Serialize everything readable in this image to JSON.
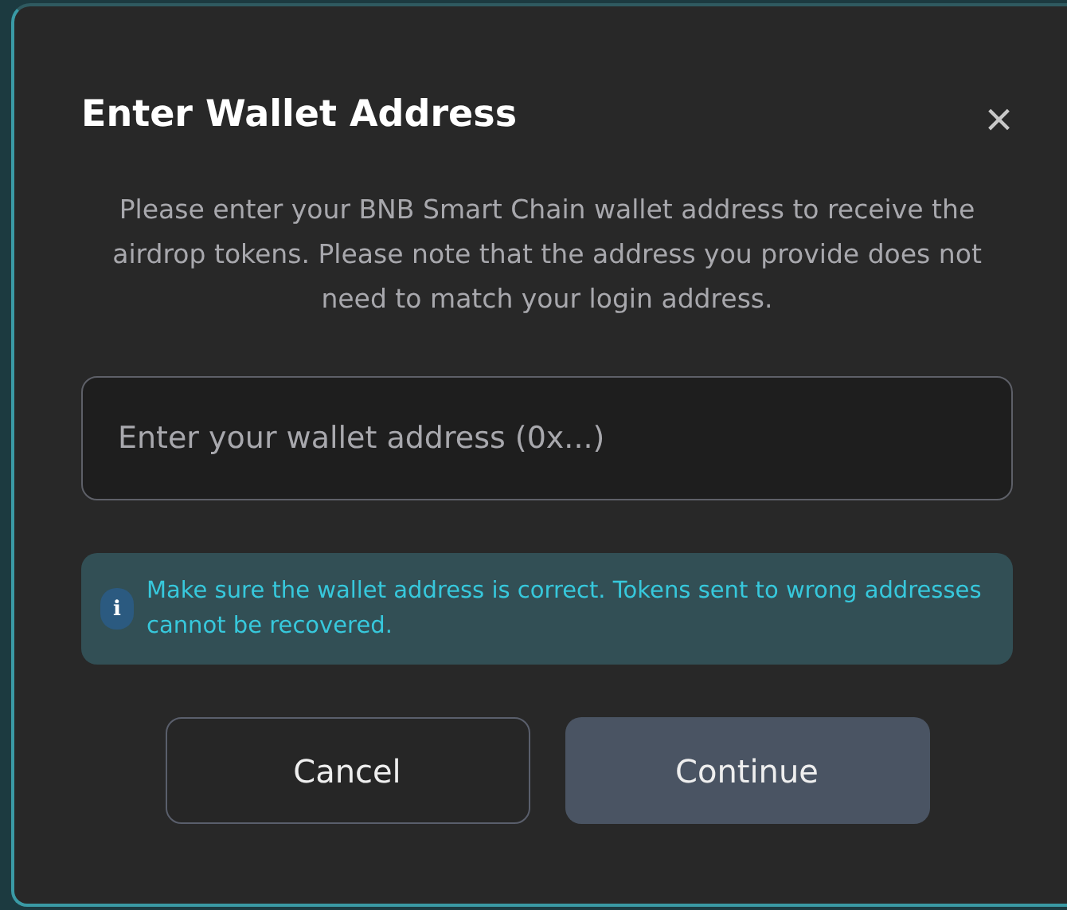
{
  "dialog": {
    "title": "Enter Wallet Address",
    "close": "×",
    "description": "Please enter your BNB Smart Chain wallet address to receive the airdrop tokens. Please note that the address you provide does not need to match your login address.",
    "address_field": {
      "placeholder": "Enter your wallet address (0x...)"
    },
    "notice": {
      "icon": "i",
      "text": "Make sure the wallet address is correct. Tokens sent to wrong addresses cannot be recovered."
    },
    "buttons": [
      {
        "label": "Cancel",
        "kind": "secondary"
      },
      {
        "label": "Continue",
        "kind": "primary"
      }
    ]
  }
}
